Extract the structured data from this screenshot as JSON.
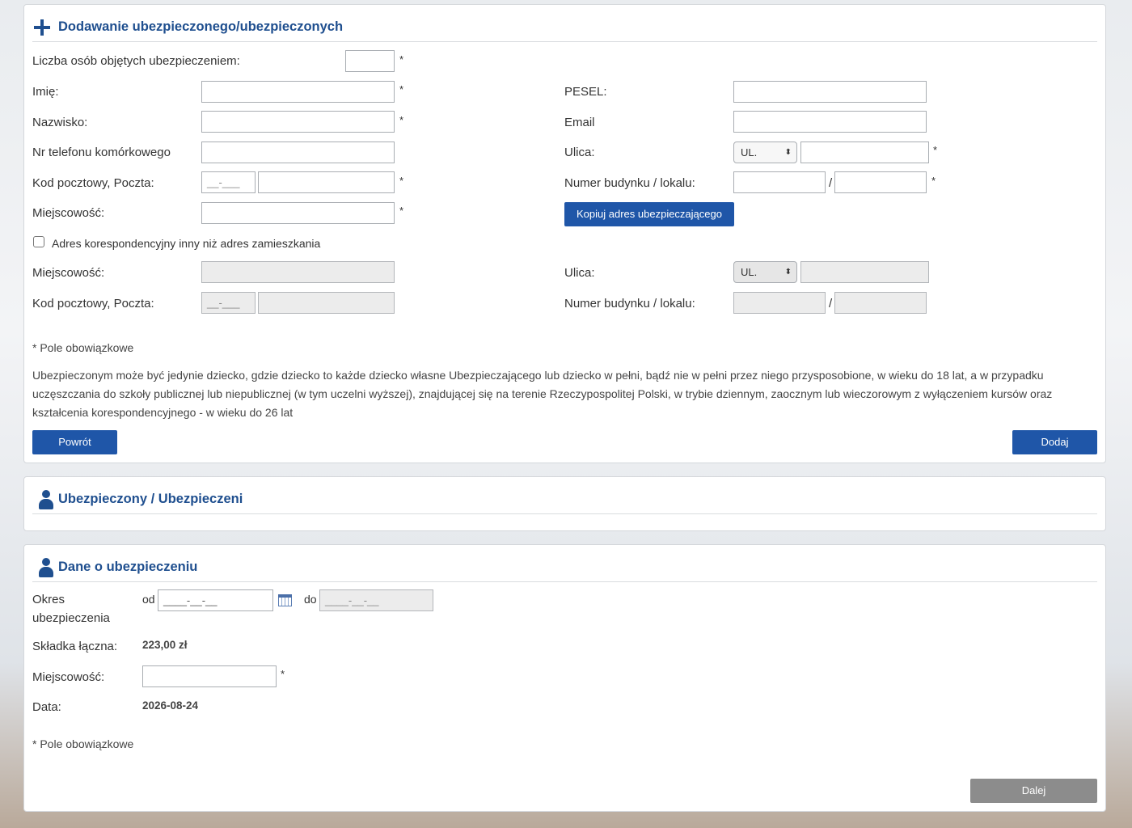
{
  "add_section": {
    "title": "Dodawanie ubezpieczonego/ubezpieczonych",
    "count_label": "Liczba osób objętych ubezpieczeniem:",
    "first_name_label": "Imię:",
    "last_name_label": "Nazwisko:",
    "phone_label": "Nr telefonu komórkowego",
    "postal_label": "Kod pocztowy, Poczta:",
    "postal_placeholder": "__-___",
    "city_label": "Miejscowość:",
    "pesel_label": "PESEL:",
    "email_label": "Email",
    "street_label": "Ulica:",
    "street_prefix": "UL.",
    "building_label": "Numer budynku / lokalu:",
    "slash": "/",
    "copy_address_button": "Kopiuj adres ubezpieczającego",
    "correspondence_checkbox_label": "Adres korespondencyjny inny niż adres zamieszkania",
    "corr_city_label": "Miejscowość:",
    "corr_postal_label": "Kod pocztowy, Poczta:",
    "corr_postal_placeholder": "__-___",
    "corr_street_label": "Ulica:",
    "corr_street_prefix": "UL.",
    "corr_building_label": "Numer budynku / lokalu:",
    "required_marker": "*",
    "required_note": "* Pole obowiązkowe",
    "info_text": "Ubezpieczonym może być jedynie dziecko, gdzie dziecko to każde dziecko własne Ubezpieczającego lub dziecko w pełni, bądź nie w pełni przez niego przysposobione, w wieku do 18 lat, a w przypadku uczęszczania do szkoły publicznej lub niepublicznej (w tym uczelni wyższej), znajdującej się na terenie Rzeczypospolitej Polski, w trybie dziennym, zaocznym lub wieczorowym z wyłączeniem kursów oraz kształcenia korespondencyjnego - w wieku do 26 lat",
    "back_button": "Powrót",
    "add_button": "Dodaj"
  },
  "insured_section": {
    "title": "Ubezpieczony / Ubezpieczeni"
  },
  "insurance_section": {
    "title": "Dane o ubezpieczeniu",
    "period_label_1": "Okres",
    "period_label_2": "ubezpieczenia",
    "from_label": "od",
    "from_placeholder": "____-__-__",
    "to_label": "do",
    "to_placeholder": "____-__-__",
    "premium_label": "Składka łączna:",
    "premium_value": "223,00 zł",
    "city_label": "Miejscowość:",
    "date_label": "Data:",
    "date_value": "2026-08-24",
    "required_marker": "*",
    "required_note": "* Pole obowiązkowe",
    "next_button": "Dalej"
  },
  "icons": {
    "add": "plus-icon",
    "person": "person-icon",
    "calendar": "calendar-icon"
  },
  "colors": {
    "accent": "#1f56a8",
    "title": "#1f4f8f",
    "disabled_button": "#8c8c8c"
  }
}
